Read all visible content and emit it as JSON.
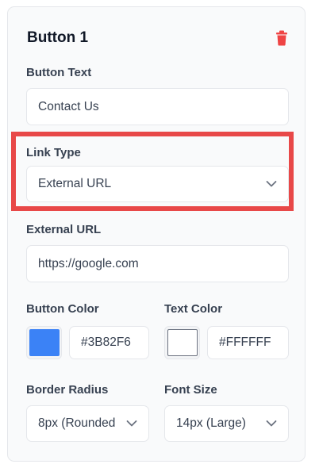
{
  "card": {
    "title": "Button 1"
  },
  "fields": {
    "button_text": {
      "label": "Button Text",
      "value": "Contact Us"
    },
    "link_type": {
      "label": "Link Type",
      "value": "External URL"
    },
    "external_url": {
      "label": "External URL",
      "value": "https://google.com"
    },
    "button_color": {
      "label": "Button Color",
      "swatch": "#3B82F6",
      "value": "#3B82F6"
    },
    "text_color": {
      "label": "Text Color",
      "swatch": "#FFFFFF",
      "value": "#FFFFFF"
    },
    "border_radius": {
      "label": "Border Radius",
      "value": "8px (Rounded"
    },
    "font_size": {
      "label": "Font Size",
      "value": "14px (Large)"
    }
  },
  "colors": {
    "delete_icon": "#ef4444",
    "highlight_box": "#e84848"
  },
  "icons": {
    "delete": "trash-icon",
    "dropdown": "chevron-down-icon"
  }
}
